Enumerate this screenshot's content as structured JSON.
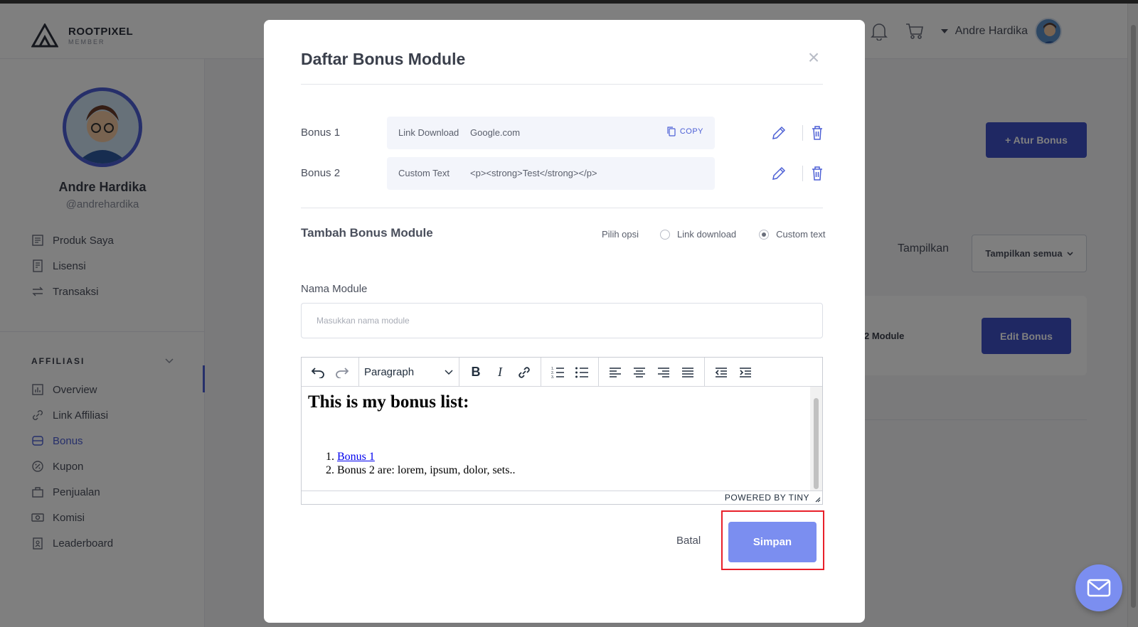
{
  "app": {
    "logo_name": "ROOTPIXEL",
    "logo_sub": "MEMBER",
    "user_name": "Andre Hardika"
  },
  "sidebar": {
    "name": "Andre Hardika",
    "handle": "@andrehardika",
    "menu": [
      {
        "label": "Produk Saya",
        "icon": "products-icon"
      },
      {
        "label": "Lisensi",
        "icon": "license-icon"
      },
      {
        "label": "Transaksi",
        "icon": "transaction-icon"
      }
    ],
    "section_title": "AFFILIASI",
    "affiliate_menu": [
      {
        "label": "Overview",
        "icon": "chart-icon"
      },
      {
        "label": "Link Affiliasi",
        "icon": "link-icon"
      },
      {
        "label": "Bonus",
        "icon": "bonus-icon",
        "active": true
      },
      {
        "label": "Kupon",
        "icon": "coupon-icon"
      },
      {
        "label": "Penjualan",
        "icon": "sales-icon"
      },
      {
        "label": "Komisi",
        "icon": "commission-icon"
      },
      {
        "label": "Leaderboard",
        "icon": "leaderboard-icon"
      }
    ]
  },
  "content": {
    "atur_bonus_label": "+ Atur Bonus",
    "tampilkan_label": "Tampilkan",
    "tampilkan_value": "Tampilkan semua",
    "module_count": "2 Module",
    "edit_bonus_label": "Edit Bonus"
  },
  "modal": {
    "title": "Daftar Bonus Module",
    "bonuses": [
      {
        "label": "Bonus 1",
        "type": "Link Download",
        "value": "Google.com",
        "copy_label": "COPY"
      },
      {
        "label": "Bonus 2",
        "type": "Custom Text",
        "value": "<p><strong>Test</strong></p>"
      }
    ],
    "add_title": "Tambah Bonus Module",
    "option_label": "Pilih opsi",
    "options": [
      {
        "label": "Link download",
        "checked": false
      },
      {
        "label": "Custom text",
        "checked": true
      }
    ],
    "field_label": "Nama Module",
    "field_placeholder": "Masukkan nama module",
    "field_value": "",
    "editor": {
      "block_format": "Paragraph",
      "heading": "This is my bonus list:",
      "list": [
        "Bonus 1",
        "Bonus 2 are: lorem, ipsum, dolor, sets.."
      ],
      "powered_by": "POWERED BY TINY"
    },
    "cancel_label": "Batal",
    "save_label": "Simpan"
  },
  "colors": {
    "primary": "#3f51c7",
    "save_button": "#7b8ef0",
    "highlight": "#e8202a"
  }
}
